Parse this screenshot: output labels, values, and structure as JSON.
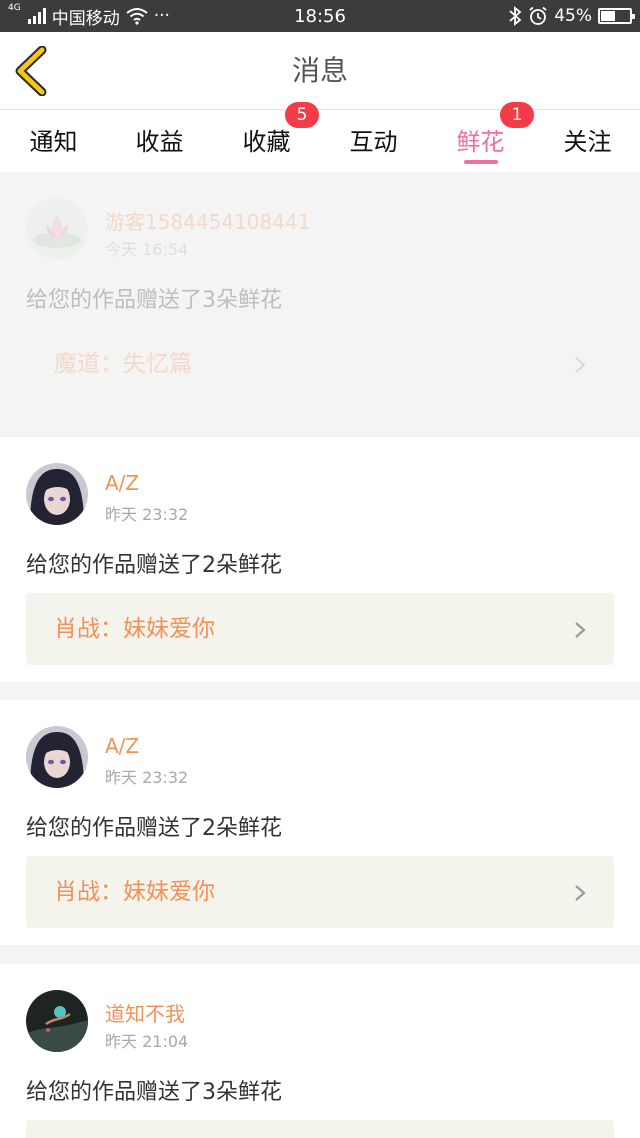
{
  "status_bar": {
    "network_tag": "4G",
    "carrier": "中国移动",
    "more": "···",
    "time": "18:56",
    "battery_text": "45%",
    "battery_level": 0.45
  },
  "nav": {
    "title": "消息",
    "back_icon": "chevron-left-icon"
  },
  "tabs": [
    {
      "label": "通知",
      "badge": ""
    },
    {
      "label": "收益",
      "badge": ""
    },
    {
      "label": "收藏",
      "badge": "5"
    },
    {
      "label": "互动",
      "badge": ""
    },
    {
      "label": "鲜花",
      "badge": "1",
      "active": true
    },
    {
      "label": "关注",
      "badge": ""
    }
  ],
  "messages": [
    {
      "user": "游客1584454108441",
      "time": "今天 16:54",
      "text": "给您的作品赠送了3朵鲜花",
      "work": "魔道：失忆篇",
      "avatar": "lotus"
    },
    {
      "user": "A/Z",
      "time": "昨天 23:32",
      "text": "给您的作品赠送了2朵鲜花",
      "work": "肖战：妹妹爱你",
      "avatar": "anime"
    },
    {
      "user": "A/Z",
      "time": "昨天 23:32",
      "text": "给您的作品赠送了2朵鲜花",
      "work": "肖战：妹妹爱你",
      "avatar": "anime"
    },
    {
      "user": "道知不我",
      "time": "昨天 21:04",
      "text": "给您的作品赠送了3朵鲜花",
      "work": "",
      "avatar": "dark"
    }
  ],
  "colors": {
    "accent_pink": "#f06ea0",
    "badge_red": "#f43b47",
    "name_orange": "#f0925a",
    "back_yellow": "#f5c518"
  }
}
